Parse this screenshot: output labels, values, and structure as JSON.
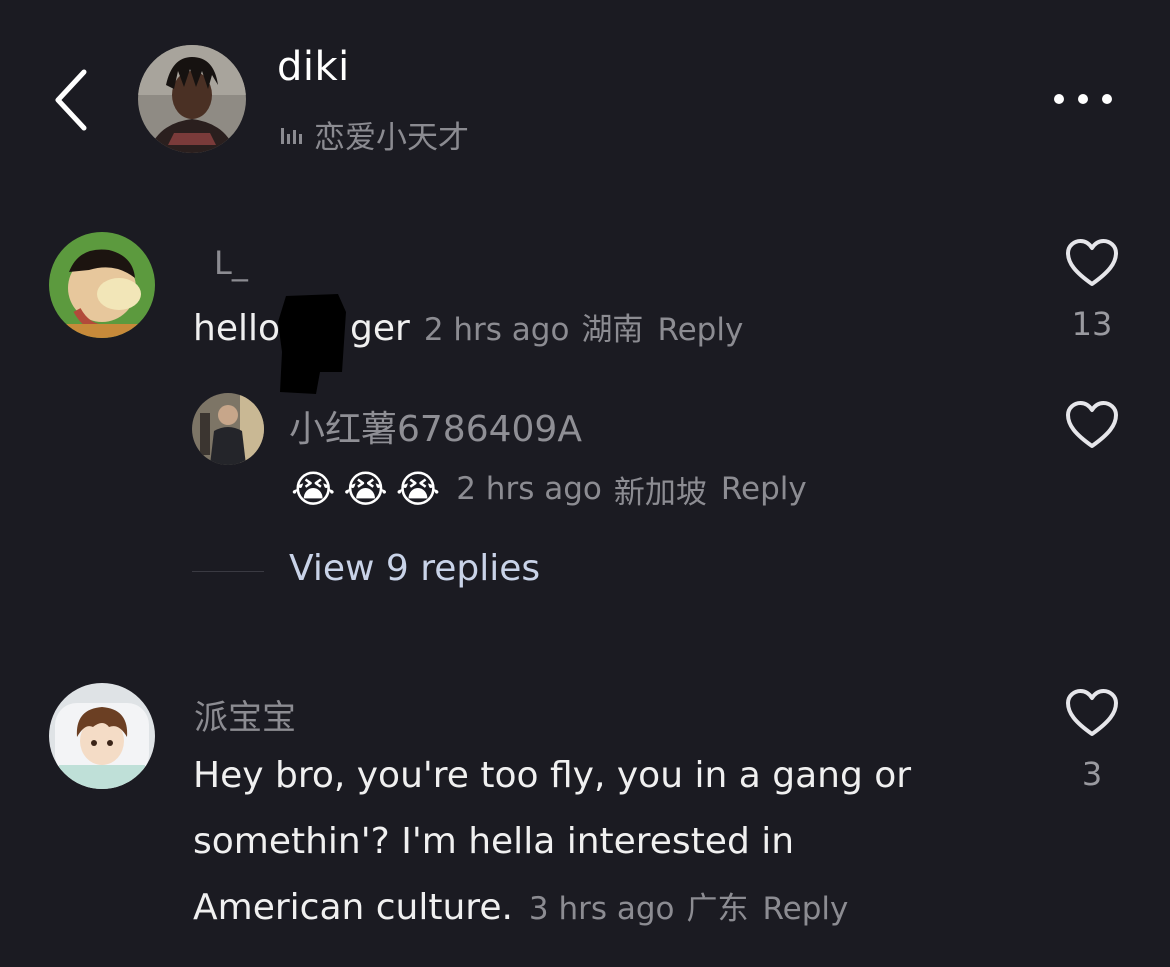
{
  "header": {
    "title": "diki",
    "subtitle": "恋爱小天才"
  },
  "comments": [
    {
      "username": "L_",
      "text_start": "hello",
      "text_end": "ger",
      "time": "2 hrs ago",
      "location": "湖南",
      "reply_label": "Reply",
      "likes": "13",
      "replies": [
        {
          "username": "小红薯6786409A",
          "emoji": "😭😭😭",
          "time": "2 hrs ago",
          "location": "新加坡",
          "reply_label": "Reply"
        }
      ],
      "view_replies": "View 9 replies"
    },
    {
      "username": "派宝宝",
      "text_lines": [
        "Hey bro, you're too fly, you in a gang or",
        "somethin'? I'm hella interested in",
        "American culture."
      ],
      "time": "3 hrs ago",
      "location": "广东",
      "reply_label": "Reply",
      "likes": "3"
    }
  ],
  "icons": {
    "back": "chevron-left-icon",
    "more": "ellipsis-icon",
    "audio": "sound-bars-icon",
    "like": "heart-outline-icon"
  },
  "colors": {
    "background": "#1b1b22",
    "muted_text": "#8c8c92",
    "link_text": "#c9d3e8"
  }
}
